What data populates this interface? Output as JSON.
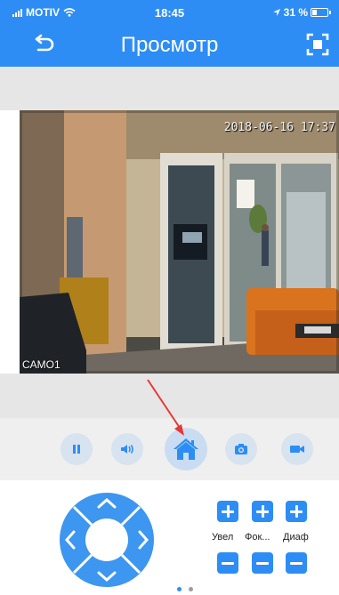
{
  "status_bar": {
    "carrier": "MOTIV",
    "time": "18:45",
    "battery_text": "31 %"
  },
  "nav": {
    "title": "Просмотр",
    "back_icon": "back-arrow-icon",
    "fullscreen_icon": "fullscreen-icon"
  },
  "video": {
    "timestamp": "2018-06-16 17:37",
    "camera_name": "CAMO1"
  },
  "controls": {
    "buttons": [
      "pause-icon",
      "speaker-icon",
      "home-icon",
      "camera-icon",
      "video-record-icon"
    ]
  },
  "ptz": {
    "zoom_label": "Увел",
    "focus_label": "Фок...",
    "iris_label": "Диаф"
  },
  "pager": {
    "total": 2,
    "active": 1
  },
  "colors": {
    "accent": "#2d8df5",
    "annotation_arrow": "#e53935"
  }
}
